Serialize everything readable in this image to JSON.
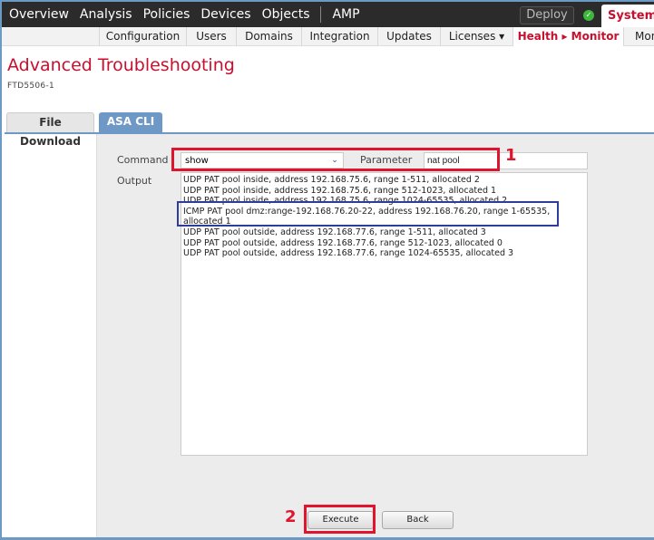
{
  "topnav": {
    "items": [
      "Overview",
      "Analysis",
      "Policies",
      "Devices",
      "Objects",
      "AMP"
    ],
    "deploy_label": "Deploy",
    "status_icon": "check-circle-icon",
    "system_label": "System"
  },
  "subnav": {
    "items": [
      "Configuration",
      "Users",
      "Domains",
      "Integration",
      "Updates",
      "Licenses ▾",
      "Health ▸ Monitor",
      "Mon"
    ],
    "active": "Health ▸ Monitor"
  },
  "page": {
    "title": "Advanced Troubleshooting",
    "device": "FTD5506-1"
  },
  "tabs": [
    {
      "label": "File Download",
      "active": false
    },
    {
      "label": "ASA CLI",
      "active": true
    }
  ],
  "form": {
    "command_label": "Command",
    "command_value": "show",
    "parameter_label": "Parameter",
    "parameter_value": "nat pool",
    "output_label": "Output",
    "output_lines": [
      "UDP PAT pool inside, address 192.168.75.6, range 1-511, allocated 2",
      "UDP PAT pool inside, address 192.168.75.6, range 512-1023, allocated 1",
      "UDP PAT pool inside, address 192.168.75.6, range 1024-65535, allocated 2",
      "ICMP PAT pool dmz:range-192.168.76.20-22, address 192.168.76.20, range 1-65535,",
      "allocated 1",
      "UDP PAT pool outside, address 192.168.77.6, range 1-511, allocated 3",
      "UDP PAT pool outside, address 192.168.77.6, range 512-1023, allocated 0",
      "UDP PAT pool outside, address 192.168.77.6, range 1024-65535, allocated 3"
    ],
    "execute_label": "Execute",
    "back_label": "Back"
  },
  "annotations": {
    "step1": "1",
    "step2": "2",
    "colors": {
      "red": "#e0142c",
      "blue": "#2e3c9c"
    }
  },
  "colors": {
    "brand_red": "#c8102e",
    "nav_dark": "#2b2b2b",
    "tab_blue": "#6e98c6"
  }
}
